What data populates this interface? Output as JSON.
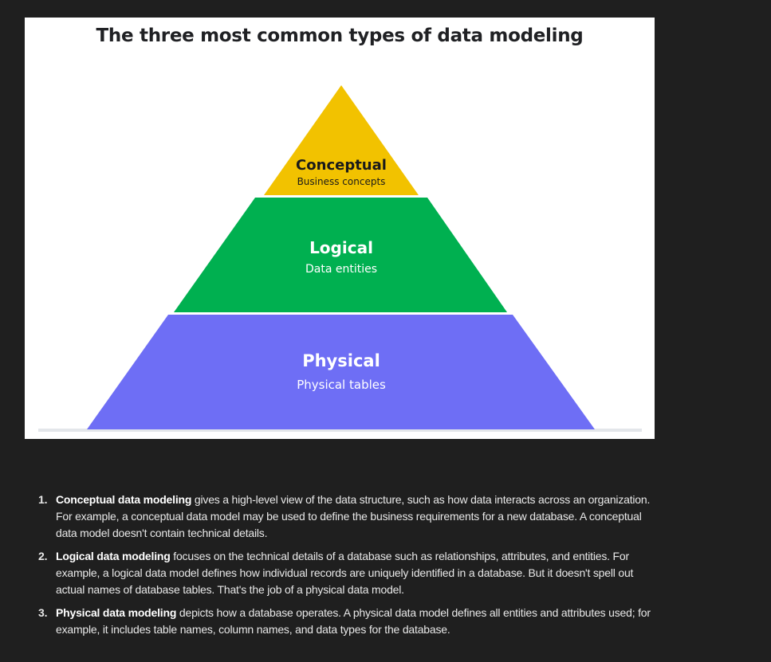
{
  "figure": {
    "title": "The three most common types of data modeling",
    "tiers": [
      {
        "name": "Conceptual",
        "subtitle": "Business concepts",
        "color": "#f2c200",
        "text_color": "#1a1a1a"
      },
      {
        "name": "Logical",
        "subtitle": "Data entities",
        "color": "#00b050",
        "text_color": "#ffffff"
      },
      {
        "name": "Physical",
        "subtitle": "Physical tables",
        "color": "#6e6ef5",
        "text_color": "#ffffff"
      }
    ],
    "baseline_color": "#e3e6ea"
  },
  "list": [
    {
      "number": "1.",
      "term": "Conceptual data modeling",
      "text": " gives a high-level view of the data structure, such as how data interacts across an organization. For example, a conceptual data model may be used to define the business requirements for a new database. A conceptual data model doesn't contain technical details."
    },
    {
      "number": "2.",
      "term": "Logical data modeling",
      "text": " focuses on the technical details of a database such as relationships, attributes, and entities. For example, a logical data model defines how individual records are uniquely identified in a database. But it doesn't spell out actual names of database tables. That's the job of a physical data model."
    },
    {
      "number": "3.",
      "term": "Physical data modeling",
      "text": " depicts how a database operates. A physical data model defines all entities and attributes used; for example, it includes table names, column names, and data types for the database."
    }
  ]
}
